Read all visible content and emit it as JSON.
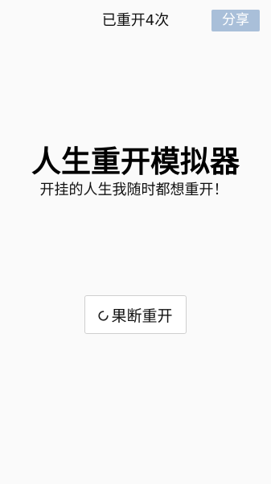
{
  "header": {
    "restart_count": "已重开4次",
    "share_label": "分享"
  },
  "main": {
    "title": "人生重开模拟器",
    "subtitle": "开挂的人生我随时都想重开！",
    "restart_button_label": "果断重开",
    "restart_button_icon": "spinner-icon"
  },
  "colors": {
    "background": "#fafafa",
    "share_button_bg": "#a9bfd9",
    "share_button_text": "#ffffff",
    "button_border": "#cfcfcf",
    "text": "#111111"
  }
}
